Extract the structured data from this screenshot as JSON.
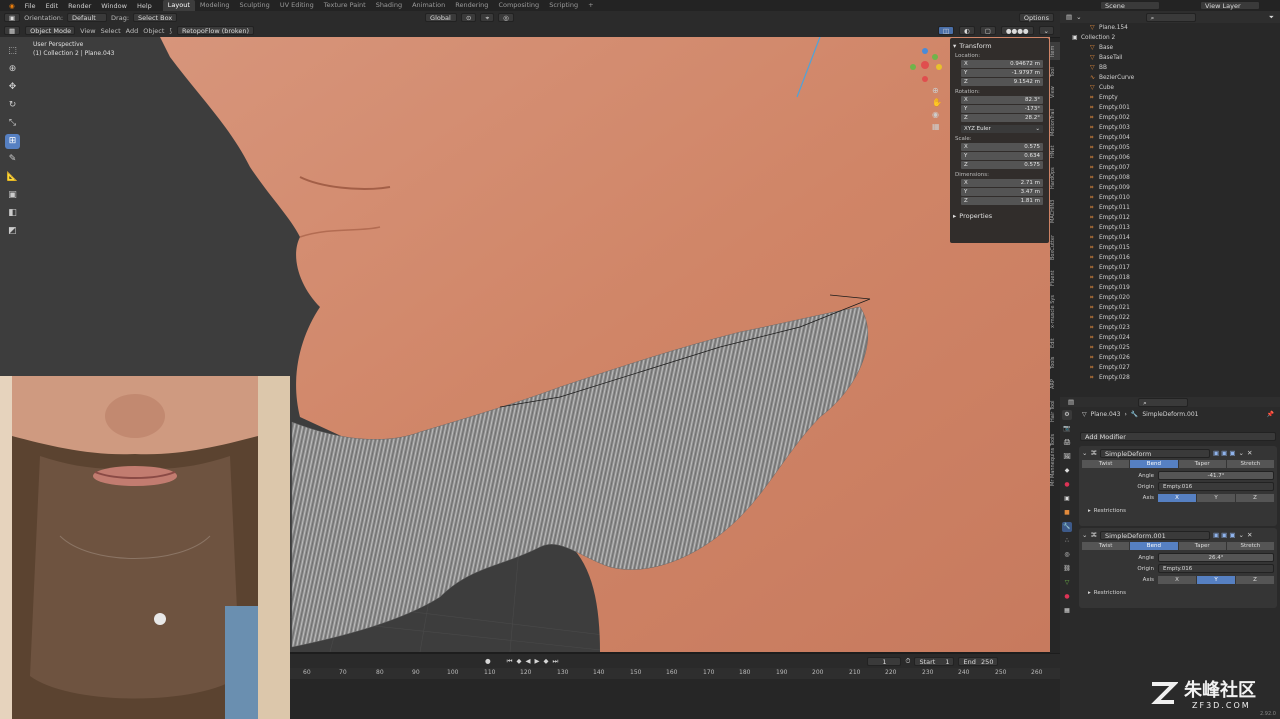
{
  "menu": [
    "File",
    "Edit",
    "Render",
    "Window",
    "Help"
  ],
  "workspaces": [
    "Layout",
    "Modeling",
    "Sculpting",
    "UV Editing",
    "Texture Paint",
    "Shading",
    "Animation",
    "Rendering",
    "Compositing",
    "Scripting"
  ],
  "active_workspace": "Layout",
  "scene_label": "Scene",
  "view_layer_label": "View Layer",
  "toolbar": {
    "orientation_label": "Orientation:",
    "orientation_value": "Default",
    "drag_label": "Drag:",
    "drag_value": "Select Box",
    "transform_orientation": "Global",
    "options_label": "Options"
  },
  "header": {
    "mode": "Object Mode",
    "view": "View",
    "select": "Select",
    "add": "Add",
    "object": "Object",
    "retopoflow": "RetopoFlow (broken)"
  },
  "viewport": {
    "perspective_label": "User Perspective",
    "object_info": "(1) Collection 2 | Plane.043"
  },
  "npanel": {
    "transform_title": "Transform",
    "location_label": "Location:",
    "location": [
      {
        "axis": "X",
        "value": "0.94672 m"
      },
      {
        "axis": "Y",
        "value": "-1.9797 m"
      },
      {
        "axis": "Z",
        "value": "9.1542 m"
      }
    ],
    "rotation_label": "Rotation:",
    "rotation": [
      {
        "axis": "X",
        "value": "82.3°"
      },
      {
        "axis": "Y",
        "value": "-173°"
      },
      {
        "axis": "Z",
        "value": "28.2°"
      }
    ],
    "rotation_mode": "XYZ Euler",
    "scale_label": "Scale:",
    "scale": [
      {
        "axis": "X",
        "value": "0.575"
      },
      {
        "axis": "Y",
        "value": "0.634"
      },
      {
        "axis": "Z",
        "value": "0.575"
      }
    ],
    "dimensions_label": "Dimensions:",
    "dimensions": [
      {
        "axis": "X",
        "value": "2.71 m"
      },
      {
        "axis": "Y",
        "value": "3.47 m"
      },
      {
        "axis": "Z",
        "value": "1.81 m"
      }
    ],
    "properties_title": "Properties"
  },
  "side_tabs": [
    "Item",
    "Tool",
    "View",
    "MotionTrail",
    "HNet",
    "HardOps",
    "MACHIN3",
    "BoxCutter",
    "Fluent",
    "x-muscle Sys",
    "Edit",
    "Tools",
    "ARP",
    "Hair Tool",
    "Mr Mannequins Tools"
  ],
  "outliner": {
    "items": [
      "Plane.154",
      "Collection 2",
      "Base",
      "BaseTail",
      "BB",
      "BezierCurve",
      "Cube",
      "Empty",
      "Empty.001",
      "Empty.002",
      "Empty.003",
      "Empty.004",
      "Empty.005",
      "Empty.006",
      "Empty.007",
      "Empty.008",
      "Empty.009",
      "Empty.010",
      "Empty.011",
      "Empty.012",
      "Empty.013",
      "Empty.014",
      "Empty.015",
      "Empty.016",
      "Empty.017",
      "Empty.018",
      "Empty.019",
      "Empty.020",
      "Empty.021",
      "Empty.022",
      "Empty.023",
      "Empty.024",
      "Empty.025",
      "Empty.026",
      "Empty.027",
      "Empty.028"
    ]
  },
  "properties": {
    "object_name": "Plane.043",
    "modifier_path": "SimpleDeform.001",
    "add_modifier": "Add Modifier",
    "modifiers": [
      {
        "name": "SimpleDeform",
        "modes": [
          "Twist",
          "Bend",
          "Taper",
          "Stretch"
        ],
        "active_mode": "Bend",
        "angle_label": "Angle",
        "angle": "-41.7°",
        "origin_label": "Origin",
        "origin": "Empty.016",
        "axis_label": "Axis",
        "axes": [
          "X",
          "Y",
          "Z"
        ],
        "active_axis": "X",
        "restrictions": "Restrictions"
      },
      {
        "name": "SimpleDeform.001",
        "modes": [
          "Twist",
          "Bend",
          "Taper",
          "Stretch"
        ],
        "active_mode": "Bend",
        "angle_label": "Angle",
        "angle": "26.4°",
        "origin_label": "Origin",
        "origin": "Empty.016",
        "axis_label": "Axis",
        "axes": [
          "X",
          "Y",
          "Z"
        ],
        "active_axis": "Y",
        "restrictions": "Restrictions"
      }
    ]
  },
  "timeline": {
    "current_frame": "1",
    "start_label": "Start",
    "start": "1",
    "end_label": "End",
    "end": "250",
    "ruler": [
      "60",
      "70",
      "80",
      "90",
      "100",
      "110",
      "120",
      "130",
      "140",
      "150",
      "160",
      "170",
      "180",
      "190",
      "200",
      "210",
      "220",
      "230",
      "240",
      "250",
      "260"
    ]
  },
  "watermark": {
    "brand": "朱峰社区",
    "url": "ZF3D.COM"
  },
  "version": "2.92.0",
  "colors": {
    "accent": "#5680c2",
    "skin": "#d08567",
    "beard": "#9a9a9a",
    "bg": "#2b2b2b"
  }
}
